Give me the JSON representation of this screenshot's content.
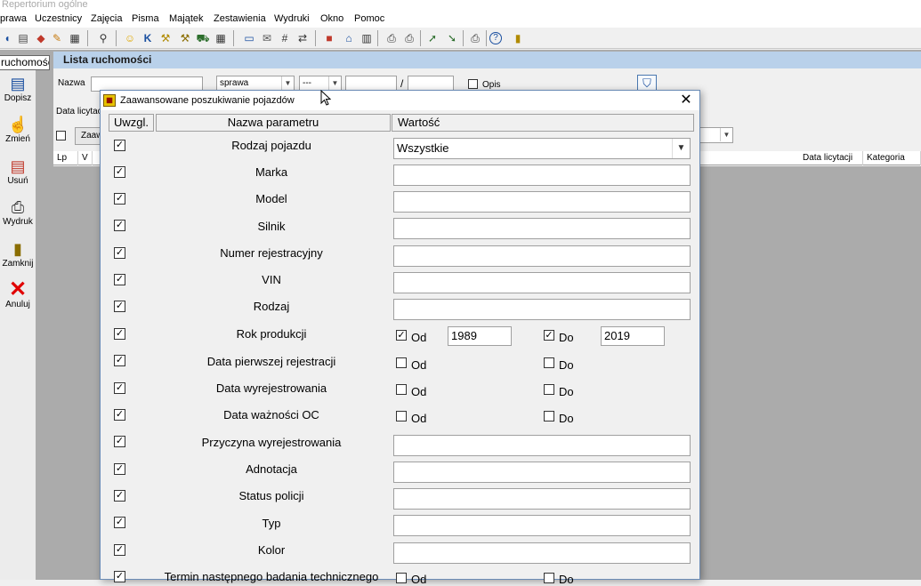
{
  "window": {
    "title": "Repertorium ogólne"
  },
  "menu": [
    "prawa",
    "Uczestnicy",
    "Zajęcia",
    "Pisma",
    "Majątek",
    "Zestawienia",
    "Wydruki",
    "Okno",
    "Pomoc"
  ],
  "left_tab": {
    "label": "ruchomość"
  },
  "sidebar": [
    {
      "label": "Dopisz",
      "icon": "add-icon"
    },
    {
      "label": "Zmień",
      "icon": "edit-icon"
    },
    {
      "label": "Usuń",
      "icon": "delete-icon"
    },
    {
      "label": "Wydruk",
      "icon": "printer-icon"
    },
    {
      "label": "Zamknij",
      "icon": "door-icon"
    },
    {
      "label": "Anuluj",
      "icon": "cancel-icon"
    }
  ],
  "list_window": {
    "title": "Lista ruchomości",
    "nazwa_label": "Nazwa",
    "sprawa_value": "sprawa",
    "dash_value": "---",
    "slash": "/",
    "opis_label": "Opis",
    "data_licytacji_label": "Data licytac",
    "zaaw_label": "Zaaw",
    "columns": {
      "lp": "Lp",
      "v": "V",
      "data_licytacji": "Data licytacji",
      "kategoria": "Kategoria"
    }
  },
  "dialog": {
    "title": "Zaawansowane poszukiwanie pojazdów",
    "headers": {
      "uwzgl": "Uwzgl.",
      "nazwa": "Nazwa parametru",
      "wartosc": "Wartość"
    },
    "check_glyph": "✓",
    "rows": [
      {
        "name": "Rodzaj pojazdu",
        "type": "combo",
        "value": "Wszystkie"
      },
      {
        "name": "Marka",
        "type": "text",
        "value": ""
      },
      {
        "name": "Model",
        "type": "text",
        "value": ""
      },
      {
        "name": "Silnik",
        "type": "text",
        "value": ""
      },
      {
        "name": "Numer rejestracyjny",
        "type": "text",
        "value": ""
      },
      {
        "name": "VIN",
        "type": "text",
        "value": ""
      },
      {
        "name": "Rodzaj",
        "type": "text",
        "value": ""
      },
      {
        "name": "Rok produkcji",
        "type": "range",
        "od_label": "Od",
        "do_label": "Do",
        "od_checked": true,
        "do_checked": true,
        "od_value": "1989",
        "do_value": "2019"
      },
      {
        "name": "Data pierwszej rejestracji",
        "type": "range",
        "od_label": "Od",
        "do_label": "Do",
        "od_checked": false,
        "do_checked": false
      },
      {
        "name": "Data wyrejestrowania",
        "type": "range",
        "od_label": "Od",
        "do_label": "Do",
        "od_checked": false,
        "do_checked": false
      },
      {
        "name": "Data ważności OC",
        "type": "range",
        "od_label": "Od",
        "do_label": "Do",
        "od_checked": false,
        "do_checked": false
      },
      {
        "name": "Przyczyna wyrejestrowania",
        "type": "text",
        "value": ""
      },
      {
        "name": "Adnotacja",
        "type": "text",
        "value": ""
      },
      {
        "name": "Status policji",
        "type": "text",
        "value": ""
      },
      {
        "name": "Typ",
        "type": "text",
        "value": ""
      },
      {
        "name": "Kolor",
        "type": "text",
        "value": ""
      },
      {
        "name": "Termin następnego badania technicznego",
        "type": "range",
        "od_label": "Od",
        "do_label": "Do",
        "od_checked": false,
        "do_checked": false
      }
    ]
  }
}
